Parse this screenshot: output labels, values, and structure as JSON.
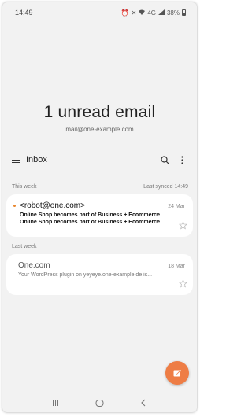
{
  "status_bar": {
    "time": "14:49",
    "network": "4G",
    "battery": "38%",
    "battery_level": 0.38
  },
  "header": {
    "title": "1 unread email",
    "account_email": "mail@one-example.com"
  },
  "toolbar": {
    "folder": "Inbox"
  },
  "sections": {
    "this_week": {
      "label": "This week",
      "last_synced": "Last synced 14:49"
    },
    "last_week": {
      "label": "Last week"
    }
  },
  "emails": [
    {
      "sender": "<robot@one.com>",
      "date": "24 Mar",
      "subject": "Online Shop becomes part of Business + Ecommerce",
      "preview": "Online Shop becomes part of Business + Ecommerce",
      "unread": true
    },
    {
      "sender": "One.com",
      "date": "18 Mar",
      "subject": "",
      "preview": "Your WordPress plugin on yeyeye.one-example.de is...",
      "unread": false
    }
  ],
  "icons": {
    "menu": "menu-icon",
    "search": "search-icon",
    "more": "more-vert-icon",
    "star": "star-outline-icon",
    "compose": "compose-icon",
    "recents": "recents-icon",
    "home": "home-icon",
    "back": "back-icon"
  },
  "colors": {
    "unread_dot": "#e8862e",
    "fab": "#ee7d45",
    "background": "#f2f2f2",
    "card": "#ffffff"
  }
}
